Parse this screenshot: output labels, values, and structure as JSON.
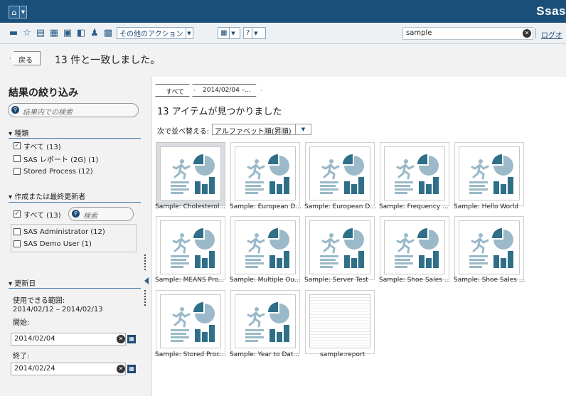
{
  "topbar": {
    "home_icon": "home-icon",
    "logo": "Ssas"
  },
  "toolbar": {
    "more_actions": "その他のアクション",
    "search_value": "sample",
    "logoff": "ログオ"
  },
  "header": {
    "back": "戻る",
    "results": "13 件と一致しました。"
  },
  "filter": {
    "title": "結果の絞り込み",
    "search_placeholder": "結果内での検索",
    "type_heading": "▾ 種類",
    "types": [
      {
        "label": "すべて (13)",
        "checked": true
      },
      {
        "label": "SAS レポート (2G) (1)",
        "checked": false
      },
      {
        "label": "Stored Process (12)",
        "checked": false
      }
    ],
    "author_heading": "▾ 作成または最終更新者",
    "author_all": "すべて (13)",
    "author_search_placeholder": "検索",
    "authors": [
      {
        "label": "SAS Administrator (12)",
        "checked": false
      },
      {
        "label": "SAS Demo User (1)",
        "checked": false
      }
    ],
    "date_heading": "▾ 更新日",
    "range_label": "使用できる範囲:",
    "range_value": "2014/02/12 – 2014/02/13",
    "start_label": "開始:",
    "start_value": "2014/02/04",
    "end_label": "終了:",
    "end_value": "2014/02/24"
  },
  "main": {
    "breadcrumbs": [
      "すべて",
      "2014/02/04 –..."
    ],
    "found": "13 アイテムが見つかりました",
    "sort_label": "次で並べ替える:",
    "sort_value": "アルファベット順(昇順)",
    "items": [
      {
        "label": "Sample: Cholesterol...",
        "kind": "stored-process",
        "selected": true
      },
      {
        "label": "Sample: European D...",
        "kind": "stored-process"
      },
      {
        "label": "Sample: European D...",
        "kind": "stored-process"
      },
      {
        "label": "Sample: Frequency ...",
        "kind": "stored-process"
      },
      {
        "label": "Sample: Hello World",
        "kind": "stored-process"
      },
      {
        "label": "Sample: MEANS Pro...",
        "kind": "stored-process"
      },
      {
        "label": "Sample: Multiple Ou...",
        "kind": "stored-process"
      },
      {
        "label": "Sample: Server Test",
        "kind": "stored-process"
      },
      {
        "label": "Sample: Shoe Sales ...",
        "kind": "stored-process"
      },
      {
        "label": "Sample: Shoe Sales ...",
        "kind": "stored-process"
      },
      {
        "label": "Sample: Stored Proc...",
        "kind": "stored-process"
      },
      {
        "label": "Sample: Year to Dat...",
        "kind": "stored-process"
      },
      {
        "label": "sample:report",
        "kind": "report"
      }
    ]
  },
  "colors": {
    "topbar": "#1a4f7a",
    "icon": "#9bb9c8",
    "icon_dark": "#2f6f88"
  }
}
